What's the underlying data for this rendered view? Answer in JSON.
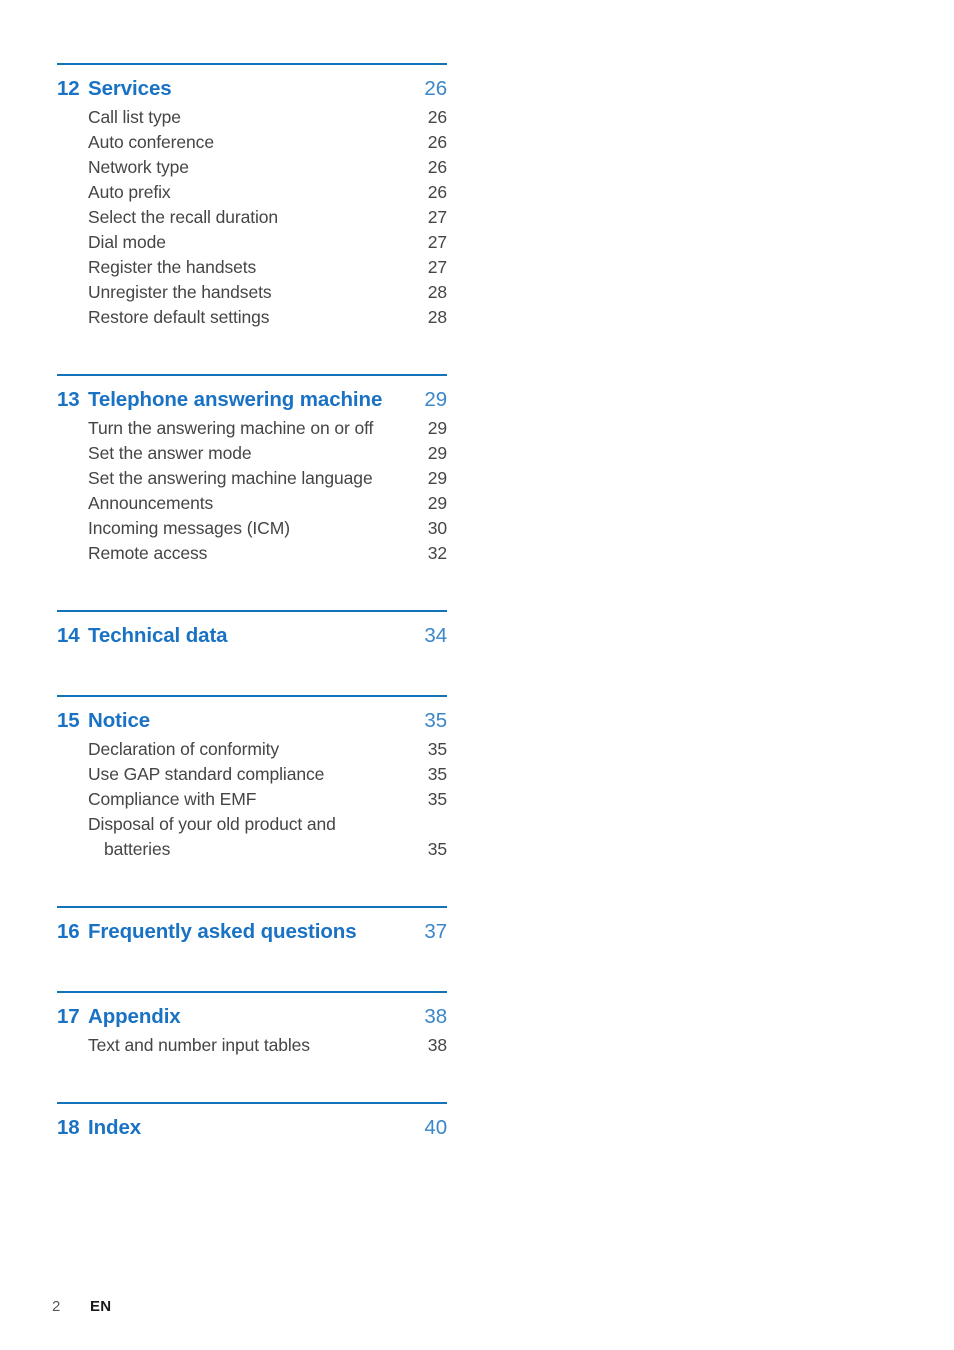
{
  "document": {
    "type": "table-of-contents",
    "accent_color": "#1a72c4",
    "rule_color": "#1473b8",
    "body_color": "#454545"
  },
  "footer": {
    "page_number": "2",
    "language": "EN"
  },
  "sections": [
    {
      "number": "12",
      "title": "Services",
      "page": "26",
      "items": [
        {
          "label": "Call list type",
          "page": "26"
        },
        {
          "label": "Auto conference",
          "page": "26"
        },
        {
          "label": "Network type",
          "page": "26"
        },
        {
          "label": "Auto prefix",
          "page": "26"
        },
        {
          "label": "Select the recall duration",
          "page": "27"
        },
        {
          "label": "Dial mode",
          "page": "27"
        },
        {
          "label": "Register the handsets",
          "page": "27"
        },
        {
          "label": "Unregister the handsets",
          "page": "28"
        },
        {
          "label": "Restore default settings",
          "page": "28"
        }
      ]
    },
    {
      "number": "13",
      "title": "Telephone answering machine",
      "page": "29",
      "items": [
        {
          "label": "Turn the answering machine on or off",
          "page": "29"
        },
        {
          "label": "Set the answer mode",
          "page": "29"
        },
        {
          "label": "Set the answering machine language",
          "page": "29"
        },
        {
          "label": "Announcements",
          "page": "29"
        },
        {
          "label": "Incoming messages (ICM)",
          "page": "30"
        },
        {
          "label": "Remote access",
          "page": "32"
        }
      ]
    },
    {
      "number": "14",
      "title": "Technical data",
      "page": "34",
      "items": []
    },
    {
      "number": "15",
      "title": "Notice",
      "page": "35",
      "items": [
        {
          "label": "Declaration of conformity",
          "page": "35"
        },
        {
          "label": "Use GAP standard compliance",
          "page": "35"
        },
        {
          "label": "Compliance with EMF",
          "page": "35"
        },
        {
          "label": "Disposal of your old product and",
          "page": ""
        },
        {
          "label": "batteries",
          "page": "35",
          "continuation": true
        }
      ]
    },
    {
      "number": "16",
      "title": "Frequently asked questions",
      "page": "37",
      "items": []
    },
    {
      "number": "17",
      "title": "Appendix",
      "page": "38",
      "items": [
        {
          "label": "Text and number input tables",
          "page": "38"
        }
      ]
    },
    {
      "number": "18",
      "title": "Index",
      "page": "40",
      "items": []
    }
  ]
}
